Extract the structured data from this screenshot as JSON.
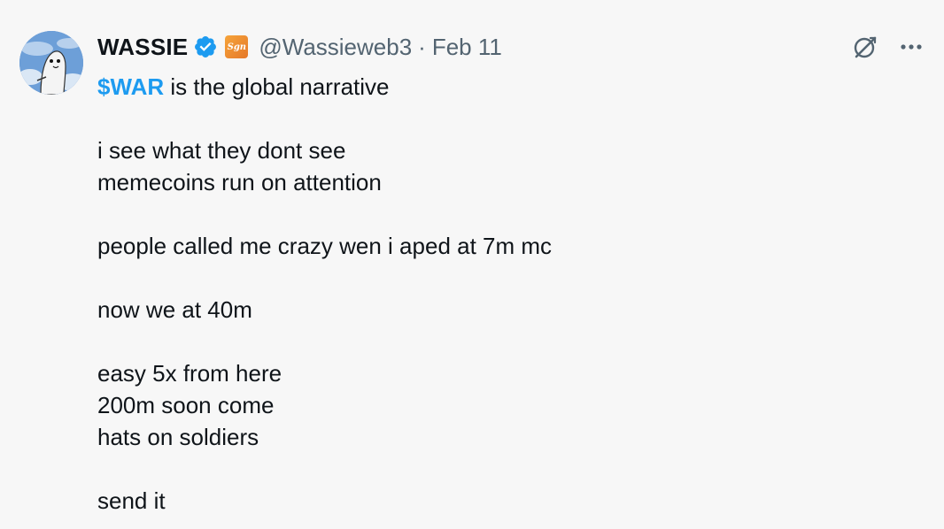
{
  "author": {
    "name": "WASSIE",
    "handle": "@Wassieweb3",
    "separator": "·",
    "date": "Feb 11",
    "verified_icon": "verified-badge-icon",
    "affiliate_badge_text": "Sgn",
    "avatar_icon": "wassie-avatar-icon"
  },
  "actions": {
    "grok_icon": "grok-icon",
    "more_icon": "more-icon"
  },
  "tweet": {
    "cashtag": "$WAR",
    "first_line_rest": " is the global narrative",
    "lines": [
      "",
      "i see what they dont see",
      "memecoins run on attention",
      "",
      "people called me crazy wen i aped at 7m mc",
      "",
      "now we at 40m",
      "",
      "easy 5x from here",
      "200m soon come",
      "hats on soldiers",
      "",
      "send it"
    ]
  },
  "colors": {
    "background": "#f7f7f7",
    "text": "#0f1419",
    "secondary": "#536471",
    "accent": "#1d9bf0"
  }
}
